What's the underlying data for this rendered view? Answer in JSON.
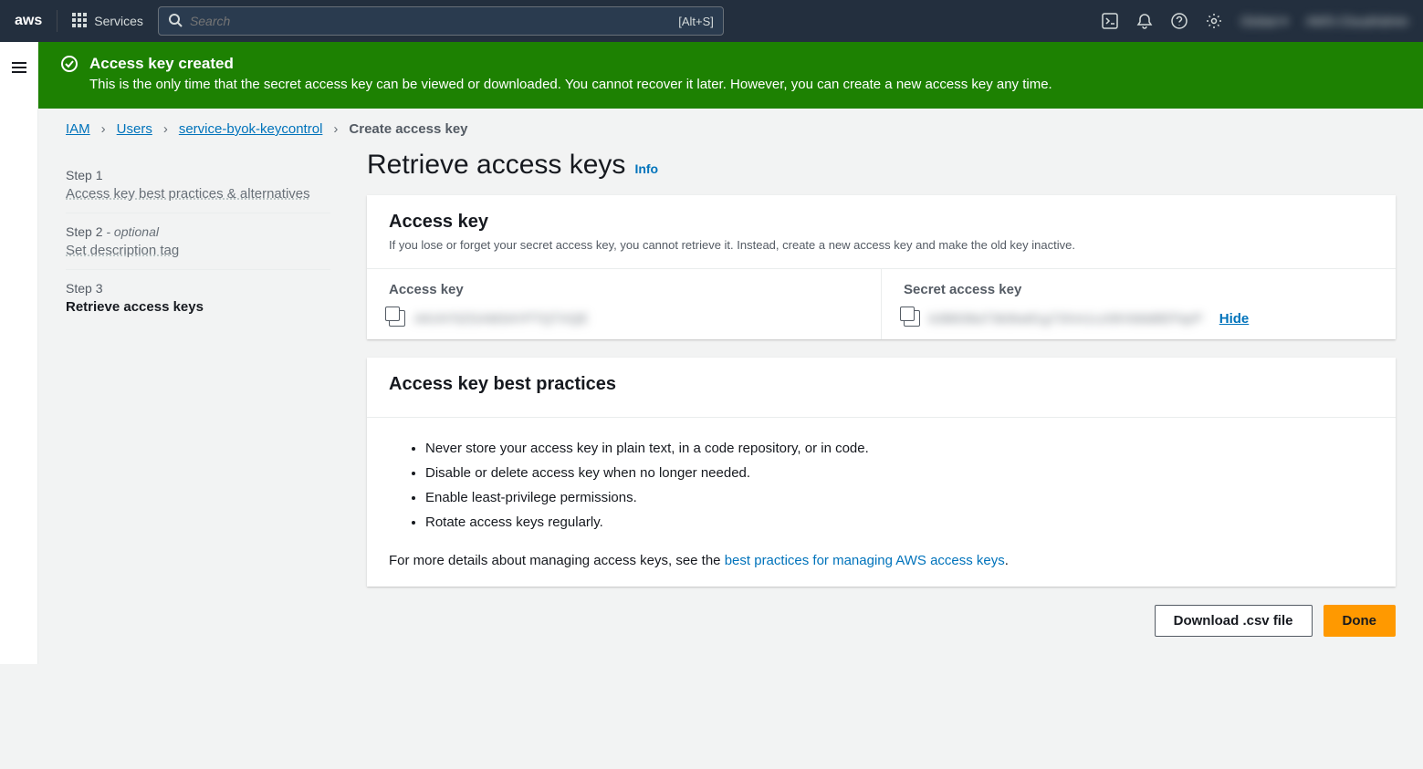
{
  "topnav": {
    "services_label": "Services",
    "search_placeholder": "Search",
    "search_kbd": "[Alt+S]",
    "region": "Global",
    "account": "AWS-CloudAdmin"
  },
  "banner": {
    "title": "Access key created",
    "message": "This is the only time that the secret access key can be viewed or downloaded. You cannot recover it later. However, you can create a new access key any time."
  },
  "breadcrumb": {
    "iam": "IAM",
    "users": "Users",
    "user": "service-byok-keycontrol",
    "current": "Create access key"
  },
  "steps": {
    "s1_label": "Step 1",
    "s1_title": "Access key best practices & alternatives",
    "s2_label": "Step 2",
    "s2_opt": " - optional",
    "s2_title": "Set description tag",
    "s3_label": "Step 3",
    "s3_title": "Retrieve access keys"
  },
  "page": {
    "title": "Retrieve access keys",
    "info": "Info"
  },
  "access_key_panel": {
    "title": "Access key",
    "desc": "If you lose or forget your secret access key, you cannot retrieve it. Instead, create a new access key and make the old key inactive.",
    "col1_label": "Access key",
    "col1_value": "AKIAY5ZGAM3AYPTQTXQE",
    "col2_label": "Secret access key",
    "col2_value": "b3B838aT3k9tw81g73Xm1cz06Vb8d8EFlqrP",
    "hide": "Hide"
  },
  "bp_panel": {
    "title": "Access key best practices",
    "items": [
      "Never store your access key in plain text, in a code repository, or in code.",
      "Disable or delete access key when no longer needed.",
      "Enable least-privilege permissions.",
      "Rotate access keys regularly."
    ],
    "footer_prefix": "For more details about managing access keys, see the ",
    "footer_link": "best practices for managing AWS access keys",
    "footer_suffix": "."
  },
  "actions": {
    "download": "Download .csv file",
    "done": "Done"
  }
}
